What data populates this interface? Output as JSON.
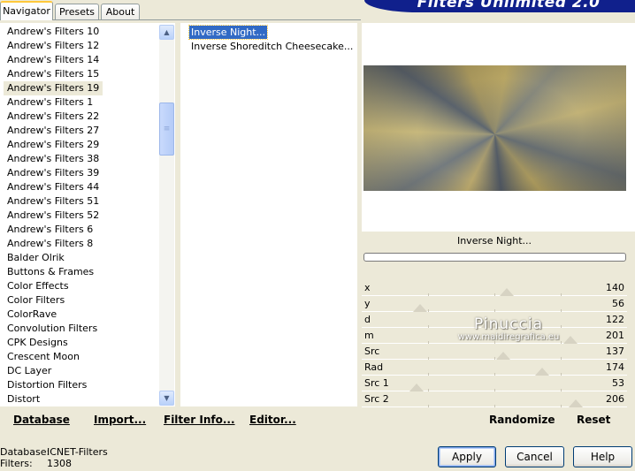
{
  "tabs": [
    "Navigator",
    "Presets",
    "About"
  ],
  "banner_title": "Filters Unlimited 2.0",
  "categories": [
    "Andrew's Filters 10",
    "Andrew's Filters 12",
    "Andrew's Filters 14",
    "Andrew's Filters 15",
    "Andrew's Filters 19",
    "Andrew's Filters 1",
    "Andrew's Filters 22",
    "Andrew's Filters 27",
    "Andrew's Filters 29",
    "Andrew's Filters 38",
    "Andrew's Filters 39",
    "Andrew's Filters 44",
    "Andrew's Filters 51",
    "Andrew's Filters 52",
    "Andrew's Filters 6",
    "Andrew's Filters 8",
    "Balder Olrik",
    "Buttons & Frames",
    "Color Effects",
    "Color Filters",
    "ColorRave",
    "Convolution Filters",
    "CPK Designs",
    "Crescent Moon",
    "DC Layer",
    "Distortion Filters",
    "Distort"
  ],
  "selected_category": "Andrew's Filters 19",
  "filters": [
    "Inverse Night...",
    "Inverse Shoreditch Cheesecake..."
  ],
  "selected_filter": "Inverse Night...",
  "preview_name": "Inverse Night...",
  "params": [
    {
      "label": "x",
      "value": "140"
    },
    {
      "label": "y",
      "value": "56"
    },
    {
      "label": "d",
      "value": "122"
    },
    {
      "label": "m",
      "value": "201"
    },
    {
      "label": "Src",
      "value": "137"
    },
    {
      "label": "Rad",
      "value": "174"
    },
    {
      "label": "Src 1",
      "value": "53"
    },
    {
      "label": "Src 2",
      "value": "206"
    }
  ],
  "watermark": {
    "name": "Pinuccia",
    "url": "www.maidiregrafica.eu"
  },
  "toolbar": {
    "database": "Database",
    "import": "Import...",
    "filter_info": "Filter Info...",
    "editor": "Editor...",
    "randomize": "Randomize",
    "reset": "Reset"
  },
  "status": {
    "database_label": "Database:",
    "database_value": "ICNET-Filters",
    "filters_label": "Filters:",
    "filters_value": "1308"
  },
  "buttons": {
    "apply": "Apply",
    "cancel": "Cancel",
    "help": "Help"
  }
}
